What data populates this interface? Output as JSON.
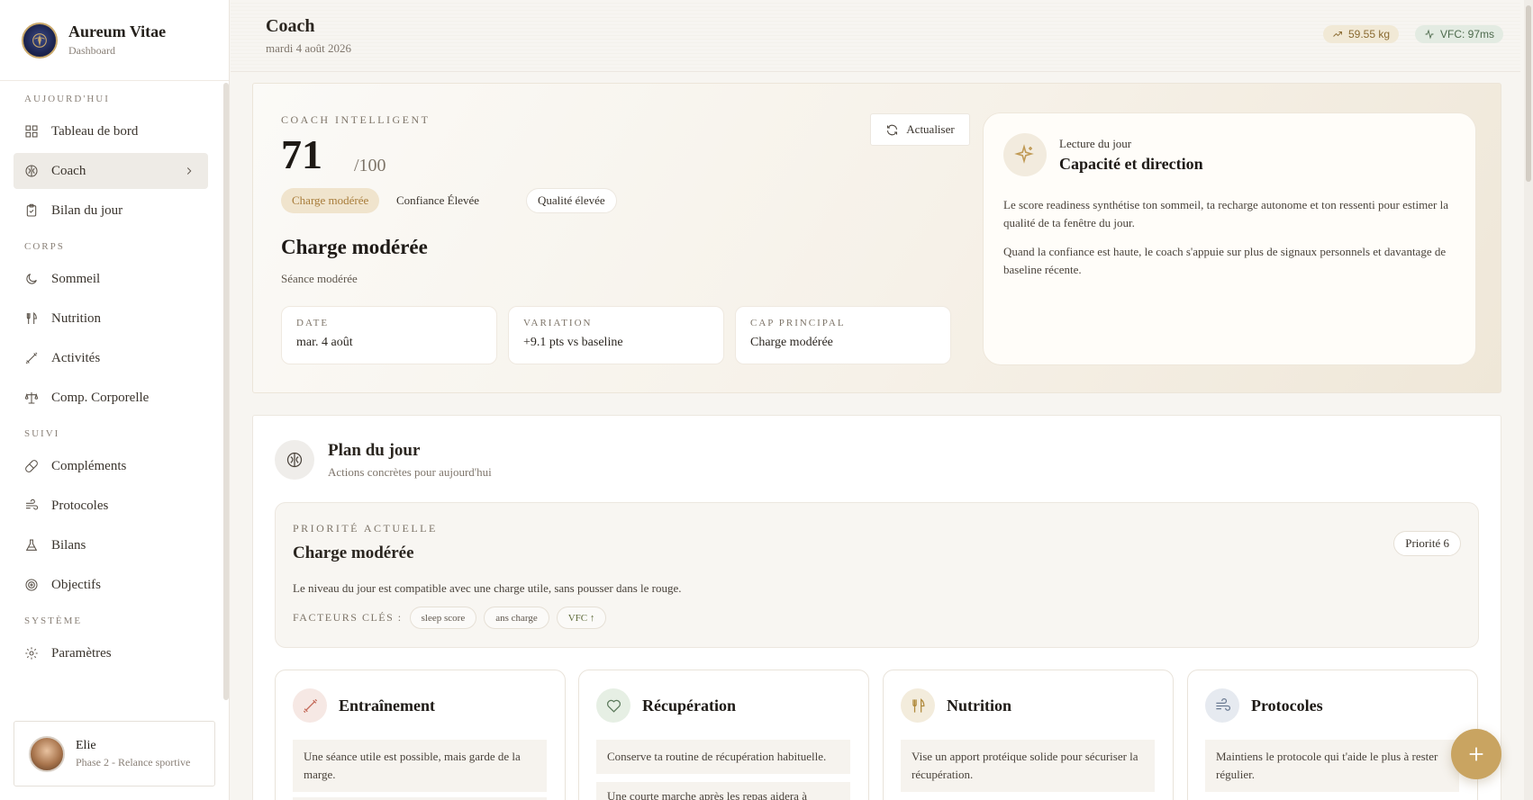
{
  "app": {
    "name": "Aureum Vitae",
    "subtitle": "Dashboard"
  },
  "sidebar": {
    "sections": [
      {
        "title": "AUJOURD'HUI",
        "items": [
          {
            "label": "Tableau de bord",
            "icon": "dashboard-icon"
          },
          {
            "label": "Coach",
            "icon": "brain-icon",
            "active": true
          },
          {
            "label": "Bilan du jour",
            "icon": "clipboard-icon"
          }
        ]
      },
      {
        "title": "CORPS",
        "items": [
          {
            "label": "Sommeil",
            "icon": "moon-icon"
          },
          {
            "label": "Nutrition",
            "icon": "utensils-icon"
          },
          {
            "label": "Activités",
            "icon": "dumbbell-icon"
          },
          {
            "label": "Comp. Corporelle",
            "icon": "scale-icon"
          }
        ]
      },
      {
        "title": "SUIVI",
        "items": [
          {
            "label": "Compléments",
            "icon": "pill-icon"
          },
          {
            "label": "Protocoles",
            "icon": "wind-icon"
          },
          {
            "label": "Bilans",
            "icon": "flask-icon"
          },
          {
            "label": "Objectifs",
            "icon": "target-icon"
          }
        ]
      },
      {
        "title": "SYSTÈME",
        "items": [
          {
            "label": "Paramètres",
            "icon": "gear-icon"
          }
        ]
      }
    ],
    "user": {
      "name": "Elie",
      "phase": "Phase 2 - Relance sportive"
    }
  },
  "header": {
    "title": "Coach",
    "date": "mardi 4 août 2026",
    "weight_badge": "59.55 kg",
    "vfc_badge": "VFC: 97ms"
  },
  "hero": {
    "label": "COACH INTELLIGENT",
    "score": "71",
    "score_max": "/100",
    "refresh": "Actualiser",
    "chips": [
      "Charge modérée",
      "Confiance Élevée",
      "Qualité élevée"
    ],
    "heading": "Charge modérée",
    "sub": "Séance modérée",
    "stats": [
      {
        "key": "DATE",
        "value": "mar. 4 août"
      },
      {
        "key": "VARIATION",
        "value": "+9.1 pts vs baseline"
      },
      {
        "key": "CAP PRINCIPAL",
        "value": "Charge modérée"
      }
    ],
    "reading": {
      "kicker": "Lecture du jour",
      "title": "Capacité et direction",
      "p1": "Le score readiness synthétise ton sommeil, ta recharge autonome et ton ressenti pour estimer la qualité de ta fenêtre du jour.",
      "p2": "Quand la confiance est haute, le coach s'appuie sur plus de signaux personnels et davantage de baseline récente."
    }
  },
  "plan": {
    "title": "Plan du jour",
    "sub": "Actions concrètes pour aujourd'hui",
    "priority": {
      "kicker": "PRIORITÉ ACTUELLE",
      "heading": "Charge modérée",
      "desc": "Le niveau du jour est compatible avec une charge utile, sans pousser dans le rouge.",
      "factors_label": "FACTEURS CLÉS :",
      "factors": [
        "sleep score",
        "ans charge",
        "VFC ↑"
      ],
      "badge": "Priorité 6"
    },
    "cards": [
      {
        "title": "Entraînement",
        "text": "Une séance utile est possible, mais garde de la marge.",
        "text2": "",
        "accent": "#c46a5a",
        "bg": "#f6e8e4"
      },
      {
        "title": "Récupération",
        "text": "Conserve ta routine de récupération habituelle.",
        "text2": "Une courte marche après les repas aidera à",
        "accent": "#5c7a5c",
        "bg": "#e6efe4"
      },
      {
        "title": "Nutrition",
        "text": "Vise un apport protéique solide pour sécuriser la récupération.",
        "text2": "",
        "accent": "#b08a3c",
        "bg": "#f3ecdc"
      },
      {
        "title": "Protocoles",
        "text": "Maintiens le protocole qui t'aide le plus à rester régulier.",
        "text2": "",
        "accent": "#6a7a92",
        "bg": "#e6eaf0"
      }
    ]
  }
}
